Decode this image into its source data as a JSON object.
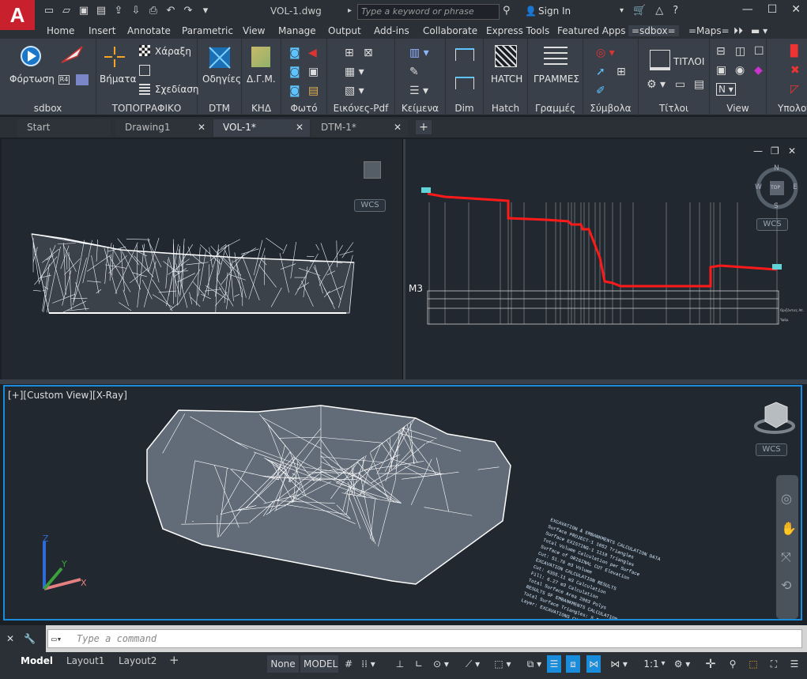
{
  "app": {
    "logo_letter": "A",
    "doc_title": "VOL-1.dwg"
  },
  "titlebar": {
    "search_placeholder": "Type a keyword or phrase",
    "sign_in": "Sign In"
  },
  "ribbon_tabs": [
    "Home",
    "Insert",
    "Annotate",
    "Parametric",
    "View",
    "Manage",
    "Output",
    "Add-ins",
    "Collaborate",
    "Express Tools",
    "Featured Apps",
    "=sdbox=",
    "=Maps="
  ],
  "ribbon_active_tab": "=sdbox=",
  "ribbon": {
    "panels": [
      {
        "title": "sdbox",
        "buttons": [
          "Φόρτωση"
        ]
      },
      {
        "title": "ΤΟΠΟΓΡΑΦΙΚΟ",
        "buttons": [
          "Βήματα",
          "Χάραξη",
          "Σχεδίαση"
        ]
      },
      {
        "title": "DTM",
        "buttons": [
          "Οδηγίες"
        ]
      },
      {
        "title": "ΚΗΔ",
        "buttons": [
          "Δ.Γ.Μ."
        ]
      },
      {
        "title": "Φωτό",
        "buttons": []
      },
      {
        "title": "Εικόνες-Pdf",
        "buttons": []
      },
      {
        "title": "Κείμενα",
        "buttons": []
      },
      {
        "title": "Dim",
        "buttons": []
      },
      {
        "title": "Hatch",
        "buttons": [
          "HATCH"
        ]
      },
      {
        "title": "Γραμμές",
        "buttons": [
          "ΓΡΑΜΜΕΣ"
        ]
      },
      {
        "title": "Σύμβολα",
        "buttons": []
      },
      {
        "title": "Τίτλοι",
        "buttons": [
          "ΤΙΤΛΟΙ"
        ]
      },
      {
        "title": "View",
        "buttons": []
      },
      {
        "title": "Υπολογ",
        "buttons": []
      }
    ]
  },
  "doc_tabs": [
    {
      "label": "Start",
      "active": false,
      "closable": false
    },
    {
      "label": "Drawing1",
      "active": false,
      "closable": true
    },
    {
      "label": "VOL-1*",
      "active": true,
      "closable": true
    },
    {
      "label": "DTM-1*",
      "active": false,
      "closable": true
    }
  ],
  "viewports": {
    "bottom_label": "[+][Custom View][X-Ray]",
    "wcs": "WCS",
    "compass": {
      "n": "N",
      "s": "S",
      "e": "E",
      "w": "W",
      "top": "TOP"
    },
    "profile_label": "M3",
    "profile_row_labels": [
      "Οριζόντιες Απ.",
      "Υψόμ."
    ],
    "report_lines": [
      "EXCAVATION & EMBANKMENTS CALCULATION DATA",
      "Surface PROJECT-1 1052 Triangles",
      "Surface EXISTING-1 1118 Triangles",
      "Total Volume Calculation per Surface",
      "Surface of ORIGINAL CUT Elevation",
      "Cut: 51.78 m3 Volume",
      "EXCAVATION CALCULATION RESULTS",
      "Cut: 4355.11 m3 Calculation",
      "Fill: 6.27 m3 Calculation",
      "Total Surface Area 2083 Polys",
      "RESULTS OF EMBANKMENTS CALCULATION",
      "Total Surface Triangles: 5 Polys",
      "Layer: EXCAVATIONS CUT Lines"
    ]
  },
  "command": {
    "placeholder": "Type a command"
  },
  "status": {
    "tabs": [
      "Model",
      "Layout1",
      "Layout2"
    ],
    "active_tab": "Model",
    "none": "None",
    "model": "MODEL",
    "scale": "1:1"
  },
  "colors": {
    "accent": "#1a8cdc",
    "profile_line": "#ff1a1a",
    "mesh": "#ffffff"
  }
}
